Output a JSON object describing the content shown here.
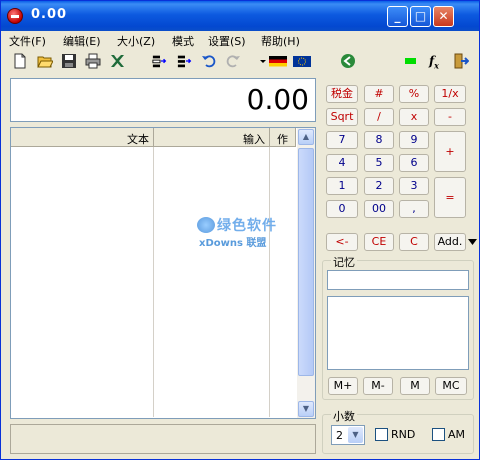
{
  "window": {
    "title": "0.00"
  },
  "menu": [
    "文件(F)",
    "编辑(E)",
    "大小(Z)",
    "模式",
    "设置(S)",
    "帮助(H)"
  ],
  "toolbar_icons": [
    "new-icon",
    "open-icon",
    "save-icon",
    "print-icon",
    "excel-icon",
    "insert-row-icon",
    "insert-column-icon",
    "undo-icon",
    "redo-icon",
    "german-flag-icon",
    "eu-flag-icon",
    "back-icon",
    "status-light-icon",
    "fx-icon",
    "exit-icon"
  ],
  "display": {
    "value": "0.00"
  },
  "list": {
    "columns": [
      "文本",
      "输入",
      "作"
    ]
  },
  "watermark": {
    "top": "绿色软件",
    "bottom": "xDowns 联盟"
  },
  "keys": {
    "tax": "税金",
    "hash": "#",
    "percent": "%",
    "reciprocal": "1/x",
    "sqrt": "Sqrt",
    "divide": "/",
    "multiply": "x",
    "minus": "-",
    "seven": "7",
    "eight": "8",
    "nine": "9",
    "plus": "+",
    "four": "4",
    "five": "5",
    "six": "6",
    "one": "1",
    "two": "2",
    "three": "3",
    "equals": "=",
    "zero": "0",
    "double_zero": "00",
    "comma": ",",
    "backspace": "<-",
    "ce": "CE",
    "c": "C",
    "add": "Add."
  },
  "memory": {
    "title": "记忆",
    "buttons": [
      "M+",
      "M-",
      "M",
      "MC"
    ]
  },
  "decimals": {
    "title": "小数",
    "value": "2",
    "rnd_label": "RND",
    "am_label": "AM"
  }
}
